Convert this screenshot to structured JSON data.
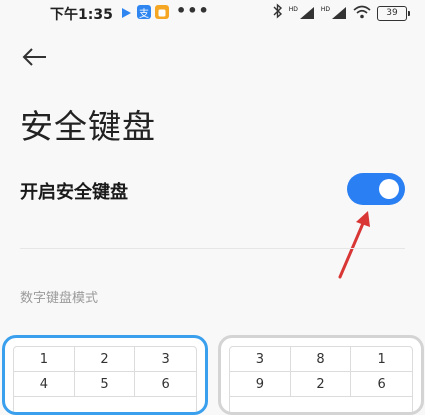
{
  "status_bar": {
    "time": "下午1:35",
    "signal_tag_1": "HD",
    "signal_tag_2": "HD",
    "battery": "39"
  },
  "page": {
    "title": "安全键盘"
  },
  "secure_keyboard": {
    "label": "开启安全键盘",
    "enabled": true
  },
  "numeric_mode": {
    "section_label": "数字键盘模式",
    "options": [
      {
        "mode": "standard",
        "selected": true,
        "keys": [
          "1",
          "2",
          "3",
          "4",
          "5",
          "6"
        ]
      },
      {
        "mode": "random",
        "selected": false,
        "keys": [
          "3",
          "8",
          "1",
          "9",
          "2",
          "6"
        ]
      }
    ]
  },
  "colors": {
    "accent": "#2a7ff2",
    "selected_border": "#3aa0ee",
    "annotation_arrow": "#d93636"
  }
}
